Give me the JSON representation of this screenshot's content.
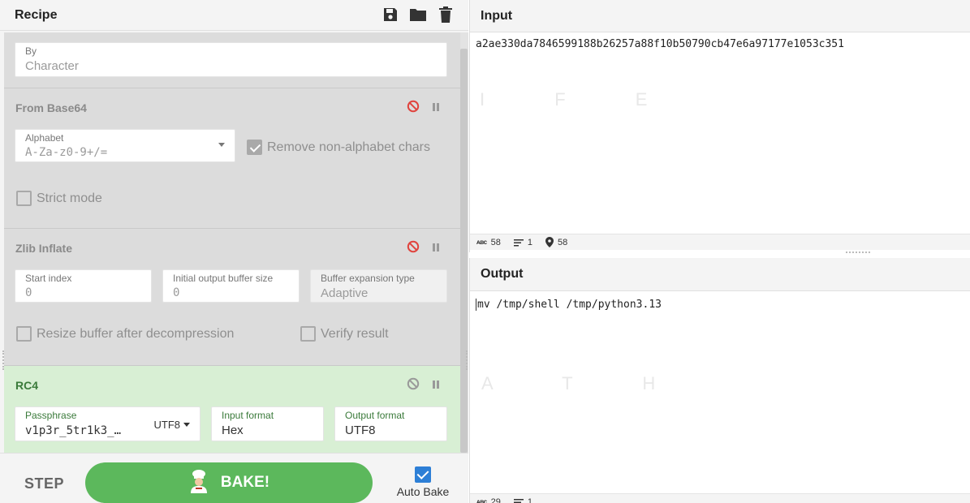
{
  "recipe": {
    "title": "Recipe",
    "icons": [
      "save-icon",
      "folder-icon",
      "trash-icon"
    ],
    "ops": {
      "by": {
        "label": "By",
        "value": "Character"
      },
      "from_base64": {
        "title": "From Base64",
        "alphabet_label": "Alphabet",
        "alphabet_value": "A-Za-z0-9+/=",
        "remove_label": "Remove non-alphabet chars",
        "remove_checked": true,
        "strict_label": "Strict mode",
        "strict_checked": false
      },
      "zlib_inflate": {
        "title": "Zlib Inflate",
        "start_index_label": "Start index",
        "start_index_value": "0",
        "initial_buffer_label": "Initial output buffer size",
        "initial_buffer_value": "0",
        "expansion_label": "Buffer expansion type",
        "expansion_value": "Adaptive",
        "resize_label": "Resize buffer after decompression",
        "resize_checked": false,
        "verify_label": "Verify result",
        "verify_checked": false
      },
      "rc4": {
        "title": "RC4",
        "passphrase_label": "Passphrase",
        "passphrase_value": "v1p3r_5tr1k3_…",
        "passphrase_encoding": "UTF8",
        "input_format_label": "Input format",
        "input_format_value": "Hex",
        "output_format_label": "Output format",
        "output_format_value": "UTF8"
      }
    },
    "step_label": "STEP",
    "bake_label": "BAKE!",
    "auto_bake_label": "Auto Bake",
    "auto_bake_checked": true
  },
  "input": {
    "title": "Input",
    "text": "a2ae330da7846599188b26257a88f10b50790cb47e6a97177e1053c351",
    "status": {
      "chars": "58",
      "lines": "1",
      "position": "58"
    }
  },
  "output": {
    "title": "Output",
    "text": "mv /tmp/shell /tmp/python3.13",
    "status": {
      "chars": "29",
      "lines": "1"
    }
  },
  "colors": {
    "bake_green": "#5cb85c",
    "disabled_icon_red": "#e0443e",
    "rc4_background": "#d8efd4",
    "auto_bake_blue": "#2d7fd6"
  }
}
